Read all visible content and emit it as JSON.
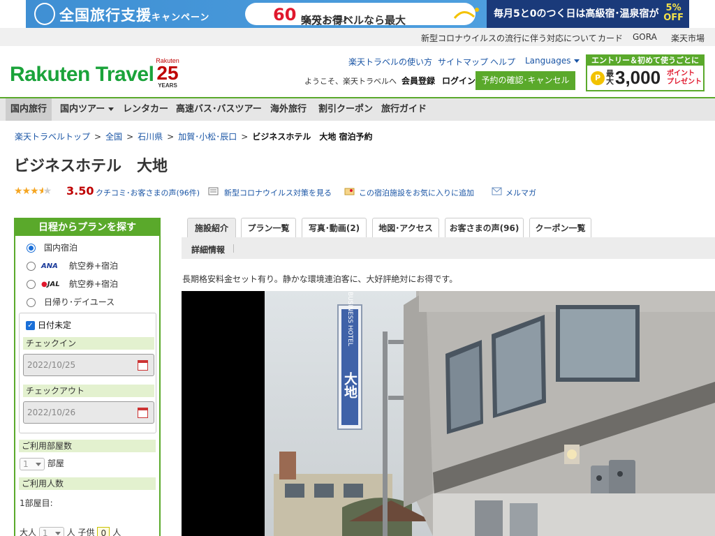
{
  "banner": {
    "title": "全国旅行支援",
    "title_small": "キャンペーン",
    "mid_text_pre": "楽天トラベルなら最大",
    "mid_highlight": "60",
    "mid_text_post": "%分お得!",
    "right_text": "毎月5と0のつく日は高級宿･温泉宿が",
    "right_discount": "5%",
    "right_off": "OFF"
  },
  "util_links": [
    "新型コロナウイルスの流行に伴う対応について",
    "カード",
    "GORA",
    "楽天市場"
  ],
  "header": {
    "logo": "Rakuten Travel",
    "years_brand": "Rakuten",
    "years_num": "25",
    "years_label": "YEARS",
    "links": [
      "楽天トラベルの使い方",
      "サイトマップ",
      "ヘルプ"
    ],
    "languages": "Languages",
    "welcome": "ようこそ、楽天トラベルへ",
    "register": "会員登録",
    "login": "ログイン",
    "reserve_button": "予約の確認･キャンセル",
    "entry_top": "エントリー＆初めて使うごとに",
    "entry_pre": "最大",
    "entry_amount": "3,000",
    "entry_point": "ポイント",
    "entry_present": "プレゼント"
  },
  "nav": [
    "国内旅行",
    "国内ツアー",
    "レンタカー",
    "高速バス･バスツアー",
    "海外旅行",
    "割引クーポン",
    "旅行ガイド"
  ],
  "breadcrumb": {
    "items": [
      "楽天トラベルトップ",
      "全国",
      "石川県",
      "加賀･小松･辰口"
    ],
    "current": "ビジネスホテル　大地 宿泊予約"
  },
  "hotel": {
    "name": "ビジネスホテル　大地",
    "score": "3.50",
    "rating_fraction": 0.7,
    "review_link": "クチコミ･お客さまの声(96件)",
    "covid_link": "新型コロナウイルス対策を見る",
    "favorite_link": "この宿泊施設をお気に入りに追加",
    "mail_link": "メルマガ",
    "description": "長期格安料金セット有り。静かな環境連泊客に、大好評絶対にお得です。"
  },
  "search": {
    "header": "日程からプランを探す",
    "options": [
      "国内宿泊",
      "航空券+宿泊",
      "航空券+宿泊",
      "日帰り･デイユース"
    ],
    "airline_ana": "ANA",
    "airline_jal": "JAL",
    "date_undecided": "日付未定",
    "checkin_label": "チェックイン",
    "checkin_value": "2022/10/25",
    "checkout_label": "チェックアウト",
    "checkout_value": "2022/10/26",
    "rooms_label": "ご利用部屋数",
    "rooms_value": "1",
    "rooms_unit": "部屋",
    "people_label": "ご利用人数",
    "room1_label": "1部屋目:",
    "adult_label": "大人",
    "adult_value": "1",
    "person_unit": "人",
    "child_label": "子供",
    "child_value": "0",
    "child_unit": "人"
  },
  "tabs": [
    "施設紹介",
    "プラン一覧",
    "写真･動画(2)",
    "地図･アクセス",
    "お客さまの声(96)",
    "クーポン一覧"
  ],
  "subtab": "詳細情報",
  "sign": {
    "vertical_en": "BUSINESS HOTEL",
    "vertical_jp": "大地"
  },
  "colors": {
    "brand_green": "#5aa92b",
    "logo_green": "#1aa33a",
    "accent_red": "#bf0000",
    "link_blue": "#1a55a5"
  }
}
